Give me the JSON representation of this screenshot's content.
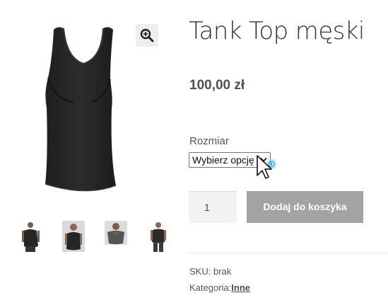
{
  "product": {
    "title": "Tank Top męski",
    "price": "100,00 zł"
  },
  "gallery": {
    "zoom_icon": "zoom-in-icon",
    "thumbnails": [
      {
        "name": "thumbnail-front"
      },
      {
        "name": "thumbnail-model-front"
      },
      {
        "name": "thumbnail-model-back"
      },
      {
        "name": "thumbnail-model-side"
      }
    ]
  },
  "variation": {
    "label": "Rozmiar",
    "select_value": "Wybierz opcję"
  },
  "cart": {
    "quantity": "1",
    "add_to_cart_label": "Dodaj do koszyka",
    "button_color": "#a3a3a3"
  },
  "meta": {
    "sku_label": "SKU:",
    "sku_value": "brak",
    "category_label": "Kategoria:",
    "category_value": "Inne"
  }
}
